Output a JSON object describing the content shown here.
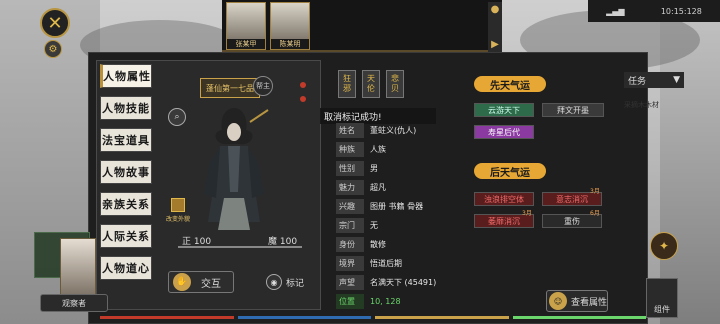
{
  "close_icon": "crossed-swords-icon",
  "top_portraits": [
    {
      "tag": "张某甲"
    },
    {
      "tag": "陈某明"
    }
  ],
  "topbar": {
    "info": "10:15:128"
  },
  "side_tabs": [
    "人物属性",
    "人物技能",
    "法宝道具",
    "人物故事",
    "亲族关系",
    "人际关系",
    "人物道心"
  ],
  "title_plaque": "蓬仙第一七品",
  "emblem": "帮主",
  "outfit_label": "改变外貌",
  "stats": {
    "left_label": "正",
    "left_value": "100",
    "right_label": "魔",
    "right_value": "100"
  },
  "buttons": {
    "interact": "交互",
    "mark": "标记",
    "view_attr": "查看属性",
    "left_bottom": "观察者",
    "right_bottom": "组件"
  },
  "traits": [
    {
      "top": "狂",
      "bottom": "邪"
    },
    {
      "top": "天",
      "bottom": "伦"
    },
    {
      "top": "悲",
      "bottom": "贝"
    }
  ],
  "toast": "取消标记成功!",
  "attributes": [
    {
      "key": "姓名",
      "value": "董蛀义(仇人)"
    },
    {
      "key": "种族",
      "value": "人族"
    },
    {
      "key": "性别",
      "value": "男"
    },
    {
      "key": "魅力",
      "value": "超凡"
    },
    {
      "key": "兴趣",
      "value": "图册    书籍    骨器"
    },
    {
      "key": "宗门",
      "value": "无"
    },
    {
      "key": "身份",
      "value": "散修"
    },
    {
      "key": "境界",
      "value": "悟道后期"
    },
    {
      "key": "声望",
      "value": "名满天下 (45491)"
    },
    {
      "key": "位置",
      "value": "10, 128",
      "green": true
    }
  ],
  "innate": {
    "title": "先天气运",
    "items": [
      {
        "label": "云游天下",
        "style": "green"
      },
      {
        "label": "拜文开墨",
        "style": "grey"
      },
      {
        "label": "寿星后代",
        "style": "purple"
      }
    ]
  },
  "acquired": {
    "title": "后天气运",
    "items": [
      {
        "label": "浊浪排空体",
        "style": "red",
        "sup": ""
      },
      {
        "label": "意志消沉",
        "style": "red",
        "sup": "3月"
      },
      {
        "label": "萎靡消沉",
        "style": "red",
        "sup": "3月"
      },
      {
        "label": "重伤",
        "style": "dark",
        "sup": "6月"
      }
    ]
  },
  "right_menu": {
    "label": "任务",
    "icon": "triangle-down-icon"
  },
  "right_text": "采摘木木材",
  "colors": {
    "accent": "#e6a734",
    "gold": "#c9a24a",
    "green": "#6bd66b",
    "panel": "#1e1e1e"
  }
}
